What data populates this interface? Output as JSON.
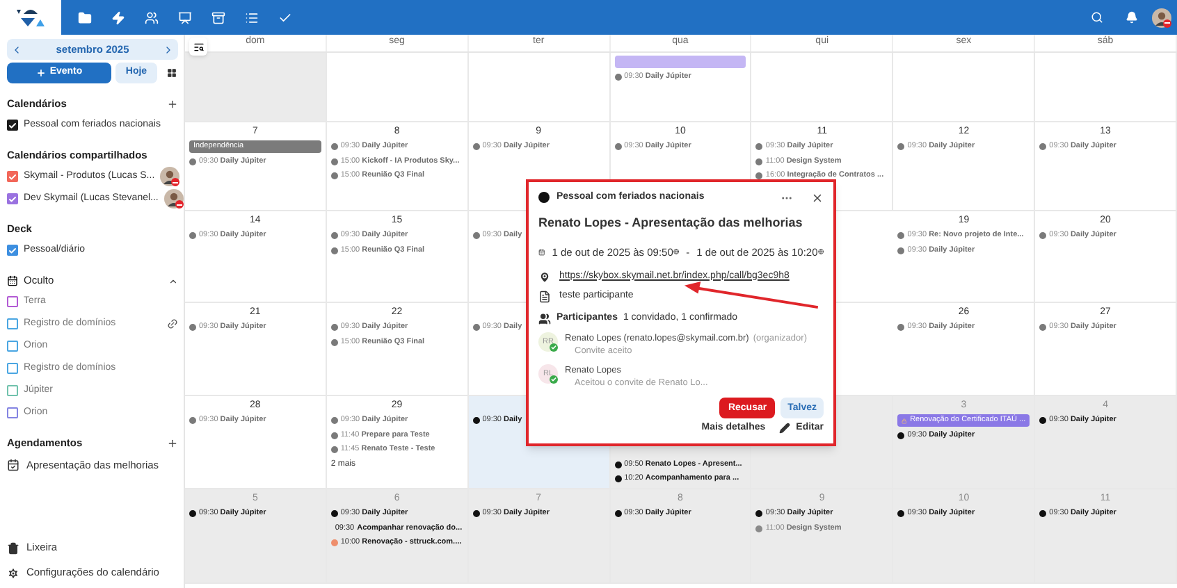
{
  "sidebar": {
    "month": "setembro 2025",
    "new_event": "Evento",
    "today_button": "Hoje",
    "sections": [
      {
        "title": "Calendários",
        "addable": true,
        "kind": "plain",
        "items": [
          {
            "kind": "calendar",
            "label": "Pessoal com feriados nacionais",
            "checked": true,
            "color": "#1a1a1a"
          }
        ]
      },
      {
        "title": "Calendários compartilhados",
        "addable": false,
        "kind": "plain",
        "items": [
          {
            "kind": "shared_calendar",
            "label": "Skymail - Produtos (Lucas S...",
            "checked": true,
            "color": "#f2675a"
          },
          {
            "kind": "shared_calendar",
            "label": "Dev Skymail (Lucas Stevanel...",
            "checked": true,
            "color": "#9a72e0"
          }
        ]
      },
      {
        "title": "Deck",
        "addable": false,
        "kind": "plain",
        "items": [
          {
            "kind": "calendar",
            "label": "Pessoal/diário",
            "checked": true,
            "color": "#3d8fe0"
          }
        ]
      },
      {
        "title": "Oculto",
        "addable": false,
        "kind": "collapsible",
        "expanded": true,
        "items": [
          {
            "kind": "calendar",
            "label": "Terra",
            "checked": false,
            "color": "#b25ad4"
          },
          {
            "kind": "linked_calendar",
            "label": "Registro de domínios",
            "checked": false,
            "color": "#4aa6e2"
          },
          {
            "kind": "calendar",
            "label": "Orion",
            "checked": false,
            "color": "#4aa6e2"
          },
          {
            "kind": "calendar",
            "label": "Registro de domínios",
            "checked": false,
            "color": "#4aa6e2"
          },
          {
            "kind": "calendar",
            "label": "Júpiter",
            "checked": false,
            "color": "#70c2ac"
          },
          {
            "kind": "calendar",
            "label": "Orion",
            "checked": false,
            "color": "#8484e2"
          }
        ]
      },
      {
        "title": "Agendamentos",
        "addable": true,
        "kind": "plain",
        "items": [
          {
            "kind": "appointment",
            "label": "Apresentação das melhorias"
          }
        ]
      }
    ],
    "footer": [
      {
        "kind": "trash",
        "label": "Lixeira"
      },
      {
        "kind": "settings",
        "label": "Configurações do calendário"
      }
    ]
  },
  "weekdays": [
    "dom",
    "seg",
    "ter",
    "qua",
    "qui",
    "sex",
    "sáb"
  ],
  "weeks": [
    {
      "days": [
        {
          "outside": true,
          "today": false
        },
        {
          "outside": false,
          "today": false
        },
        {
          "outside": false,
          "today": false
        },
        {
          "outside": false,
          "today": false,
          "events": [
            {
              "kind": "bar",
              "color": "#c4b6f4",
              "locked": false
            },
            {
              "kind": "dot",
              "time": "09:30",
              "title": "Daily Júpiter",
              "color": "#7a7a7a",
              "faded": true
            }
          ]
        },
        {
          "outside": false,
          "today": false
        },
        {
          "outside": false,
          "today": false
        },
        {
          "outside": false,
          "today": false
        }
      ]
    },
    {
      "days": [
        {
          "number": "7",
          "outside": false,
          "today": false,
          "events": [
            {
              "kind": "bar",
              "title": "Independência",
              "color": "#7b7b7b",
              "locked": false
            },
            {
              "kind": "dot",
              "time": "09:30",
              "title": "Daily Júpiter",
              "color": "#7a7a7a",
              "faded": true
            }
          ]
        },
        {
          "number": "8",
          "outside": false,
          "today": false,
          "events": [
            {
              "kind": "dot",
              "time": "09:30",
              "title": "Daily Júpiter",
              "color": "#7a7a7a",
              "faded": true
            },
            {
              "kind": "dot",
              "time": "15:00",
              "title": "Kickoff - IA Produtos Sky...",
              "color": "#7a7a7a",
              "faded": true
            },
            {
              "kind": "dot",
              "time": "15:00",
              "title": "Reunião Q3 Final",
              "color": "#7a7a7a",
              "faded": true
            }
          ]
        },
        {
          "number": "9",
          "outside": false,
          "today": false,
          "events": [
            {
              "kind": "dot",
              "time": "09:30",
              "title": "Daily Júpiter",
              "color": "#7a7a7a",
              "faded": true
            }
          ]
        },
        {
          "number": "10",
          "outside": false,
          "today": false,
          "events": [
            {
              "kind": "dot",
              "time": "09:30",
              "title": "Daily Júpiter",
              "color": "#7a7a7a",
              "faded": true
            }
          ]
        },
        {
          "number": "11",
          "outside": false,
          "today": false,
          "events": [
            {
              "kind": "dot",
              "time": "09:30",
              "title": "Daily Júpiter",
              "color": "#7a7a7a",
              "faded": true
            },
            {
              "kind": "dot",
              "time": "11:00",
              "title": "Design System",
              "color": "#7a7a7a",
              "faded": true
            },
            {
              "kind": "dot",
              "time": "16:00",
              "title": "Integração de Contratos ...",
              "color": "#7a7a7a",
              "faded": true
            }
          ]
        },
        {
          "number": "12",
          "outside": false,
          "today": false,
          "events": [
            {
              "kind": "dot",
              "time": "09:30",
              "title": "Daily Júpiter",
              "color": "#7a7a7a",
              "faded": true
            }
          ]
        },
        {
          "number": "13",
          "outside": false,
          "today": false,
          "events": [
            {
              "kind": "dot",
              "time": "09:30",
              "title": "Daily Júpiter",
              "color": "#7a7a7a",
              "faded": true
            }
          ]
        }
      ]
    },
    {
      "days": [
        {
          "number": "14",
          "outside": false,
          "today": false,
          "events": [
            {
              "kind": "dot",
              "time": "09:30",
              "title": "Daily Júpiter",
              "color": "#7a7a7a",
              "faded": true
            }
          ]
        },
        {
          "number": "15",
          "outside": false,
          "today": false,
          "events": [
            {
              "kind": "dot",
              "time": "09:30",
              "title": "Daily Júpiter",
              "color": "#7a7a7a",
              "faded": true
            },
            {
              "kind": "dot",
              "time": "15:00",
              "title": "Reunião Q3 Final",
              "color": "#7a7a7a",
              "faded": true
            }
          ]
        },
        {
          "outside": false,
          "today": false,
          "events": [
            {
              "kind": "dot",
              "time": "09:30",
              "title": "Daily",
              "color": "#7a7a7a",
              "faded": true
            }
          ]
        },
        {
          "number": "19",
          "outside": false,
          "today": false,
          "resumes_after_popup": true,
          "events": [
            {
              "kind": "dot",
              "time": "09:30",
              "title": "Re: Novo projeto de Inte...",
              "color": "#7a7a7a",
              "faded": true
            },
            {
              "kind": "dot",
              "time": "09:30",
              "title": "Daily Júpiter",
              "color": "#7a7a7a",
              "faded": true
            }
          ]
        },
        {
          "number": "20",
          "outside": false,
          "today": false,
          "events": [
            {
              "kind": "dot",
              "time": "09:30",
              "title": "Daily Júpiter",
              "color": "#7a7a7a",
              "faded": true
            }
          ]
        }
      ]
    },
    {
      "days": [
        {
          "number": "21",
          "outside": false,
          "today": false,
          "events": [
            {
              "kind": "dot",
              "time": "09:30",
              "title": "Daily Júpiter",
              "color": "#7a7a7a",
              "faded": true
            }
          ]
        },
        {
          "number": "22",
          "outside": false,
          "today": false,
          "events": [
            {
              "kind": "dot",
              "time": "09:30",
              "title": "Daily Júpiter",
              "color": "#7a7a7a",
              "faded": true
            },
            {
              "kind": "dot",
              "time": "15:00",
              "title": "Reunião Q3 Final",
              "color": "#7a7a7a",
              "faded": true
            }
          ]
        },
        {
          "outside": false,
          "today": false,
          "events": [
            {
              "kind": "dot",
              "time": "09:30",
              "title": "Daily",
              "color": "#7a7a7a",
              "faded": true
            }
          ]
        },
        {
          "number": "26",
          "outside": false,
          "today": false,
          "resumes_after_popup": true,
          "events": [
            {
              "kind": "dot",
              "time": "09:30",
              "title": "Daily Júpiter",
              "color": "#7a7a7a",
              "faded": true
            }
          ]
        },
        {
          "number": "27",
          "outside": false,
          "today": false,
          "events": [
            {
              "kind": "dot",
              "time": "09:30",
              "title": "Daily Júpiter",
              "color": "#7a7a7a",
              "faded": true
            }
          ]
        }
      ]
    },
    {
      "days": [
        {
          "number": "28",
          "outside": false,
          "today": false,
          "events": [
            {
              "kind": "dot",
              "time": "09:30",
              "title": "Daily Júpiter",
              "color": "#7a7a7a",
              "faded": true
            }
          ]
        },
        {
          "number": "29",
          "outside": false,
          "today": false,
          "more": "2 mais",
          "events": [
            {
              "kind": "dot",
              "time": "09:30",
              "title": "Daily Júpiter",
              "color": "#7a7a7a",
              "faded": true
            },
            {
              "kind": "dot",
              "time": "11:40",
              "title": "Prepare para Teste",
              "color": "#7a7a7a",
              "faded": true
            },
            {
              "kind": "dot",
              "time": "11:45",
              "title": "Renato Teste - Teste",
              "color": "#7a7a7a",
              "faded": true
            }
          ]
        },
        {
          "today": true,
          "events": [
            {
              "kind": "dot",
              "time": "09:30",
              "title": "Daily",
              "color": "#111111",
              "faded": false
            }
          ]
        },
        {
          "outside": true,
          "today": false,
          "covered_top": true,
          "events": [
            {
              "kind": "dot",
              "time": "09:50",
              "title": "Renato Lopes - Apresent...",
              "color": "#111111",
              "faded": false
            },
            {
              "kind": "dot",
              "time": "10:20",
              "title": "Acompanhamento para ...",
              "color": "#111111",
              "faded": false
            }
          ]
        },
        {
          "outside": true,
          "today": false
        },
        {
          "number": "3",
          "outside": true,
          "today": false,
          "events": [
            {
              "kind": "bar",
              "title": "Renovação do Certificado ITAÚ ...",
              "color": "#8a78e6",
              "locked": true
            },
            {
              "kind": "dot",
              "time": "09:30",
              "title": "Daily Júpiter",
              "color": "#111111",
              "faded": false
            }
          ]
        },
        {
          "number": "4",
          "outside": true,
          "today": false,
          "events": [
            {
              "kind": "dot",
              "time": "09:30",
              "title": "Daily Júpiter",
              "color": "#111111",
              "faded": false
            }
          ]
        }
      ]
    },
    {
      "days": [
        {
          "number": "5",
          "outside": true,
          "today": false,
          "events": [
            {
              "kind": "dot",
              "time": "09:30",
              "title": "Daily Júpiter",
              "color": "#111111",
              "faded": false
            }
          ]
        },
        {
          "number": "6",
          "outside": true,
          "today": false,
          "events": [
            {
              "kind": "dot",
              "time": "09:30",
              "title": "Daily Júpiter",
              "color": "#111111",
              "faded": false
            },
            {
              "kind": "plain",
              "time": "09:30",
              "title": "Acompanhar renovação do...",
              "faded": false
            },
            {
              "kind": "dot",
              "time": "10:00",
              "title": "Renovação - sttruck.com....",
              "color": "#ee8e6c",
              "faded": false
            }
          ]
        },
        {
          "number": "7",
          "outside": true,
          "today": false,
          "events": [
            {
              "kind": "dot",
              "time": "09:30",
              "title": "Daily Júpiter",
              "color": "#111111",
              "faded": false
            }
          ]
        },
        {
          "number": "8",
          "outside": true,
          "today": false,
          "events": [
            {
              "kind": "dot",
              "time": "09:30",
              "title": "Daily Júpiter",
              "color": "#111111",
              "faded": false
            }
          ]
        },
        {
          "number": "9",
          "outside": true,
          "today": false,
          "events": [
            {
              "kind": "dot",
              "time": "09:30",
              "title": "Daily Júpiter",
              "color": "#111111",
              "faded": false
            },
            {
              "kind": "dot",
              "time": "11:00",
              "title": "Design System",
              "color": "#8a8a8a",
              "faded": true
            }
          ]
        },
        {
          "number": "10",
          "outside": true,
          "today": false,
          "events": [
            {
              "kind": "dot",
              "time": "09:30",
              "title": "Daily Júpiter",
              "color": "#111111",
              "faded": false
            }
          ]
        },
        {
          "number": "11",
          "outside": true,
          "today": false,
          "events": [
            {
              "kind": "dot",
              "time": "09:30",
              "title": "Daily Júpiter",
              "color": "#111111",
              "faded": false
            }
          ]
        }
      ]
    }
  ],
  "popup": {
    "calendar": {
      "name": "Pessoal com feriados nacionais",
      "color": "#111111"
    },
    "title": "Renato Lopes - Apresentação das melhorias",
    "start": "1 de out de 2025 às 09:50",
    "separator": "-",
    "end": "1 de out de 2025 às 10:20",
    "location": "https://skybox.skymail.net.br/index.php/call/bg3ec9h8",
    "description": "teste participante",
    "participants_label": "Participantes",
    "participants_summary": "1 convidado, 1 confirmado",
    "attendees": [
      {
        "initials": "RR",
        "color": "#eef3df",
        "name": "Renato Lopes (renato.lopes@skymail.com.br)",
        "role": "(organizador)",
        "status": "Convite aceito",
        "accepted": true
      },
      {
        "initials": "RL",
        "color": "#f7e6ea",
        "name": "Renato Lopes",
        "status": "Aceitou o convite de Renato Lo...",
        "accepted": true
      }
    ],
    "decline": "Recusar",
    "maybe": "Talvez",
    "more_details": "Mais detalhes",
    "edit": "Editar"
  }
}
